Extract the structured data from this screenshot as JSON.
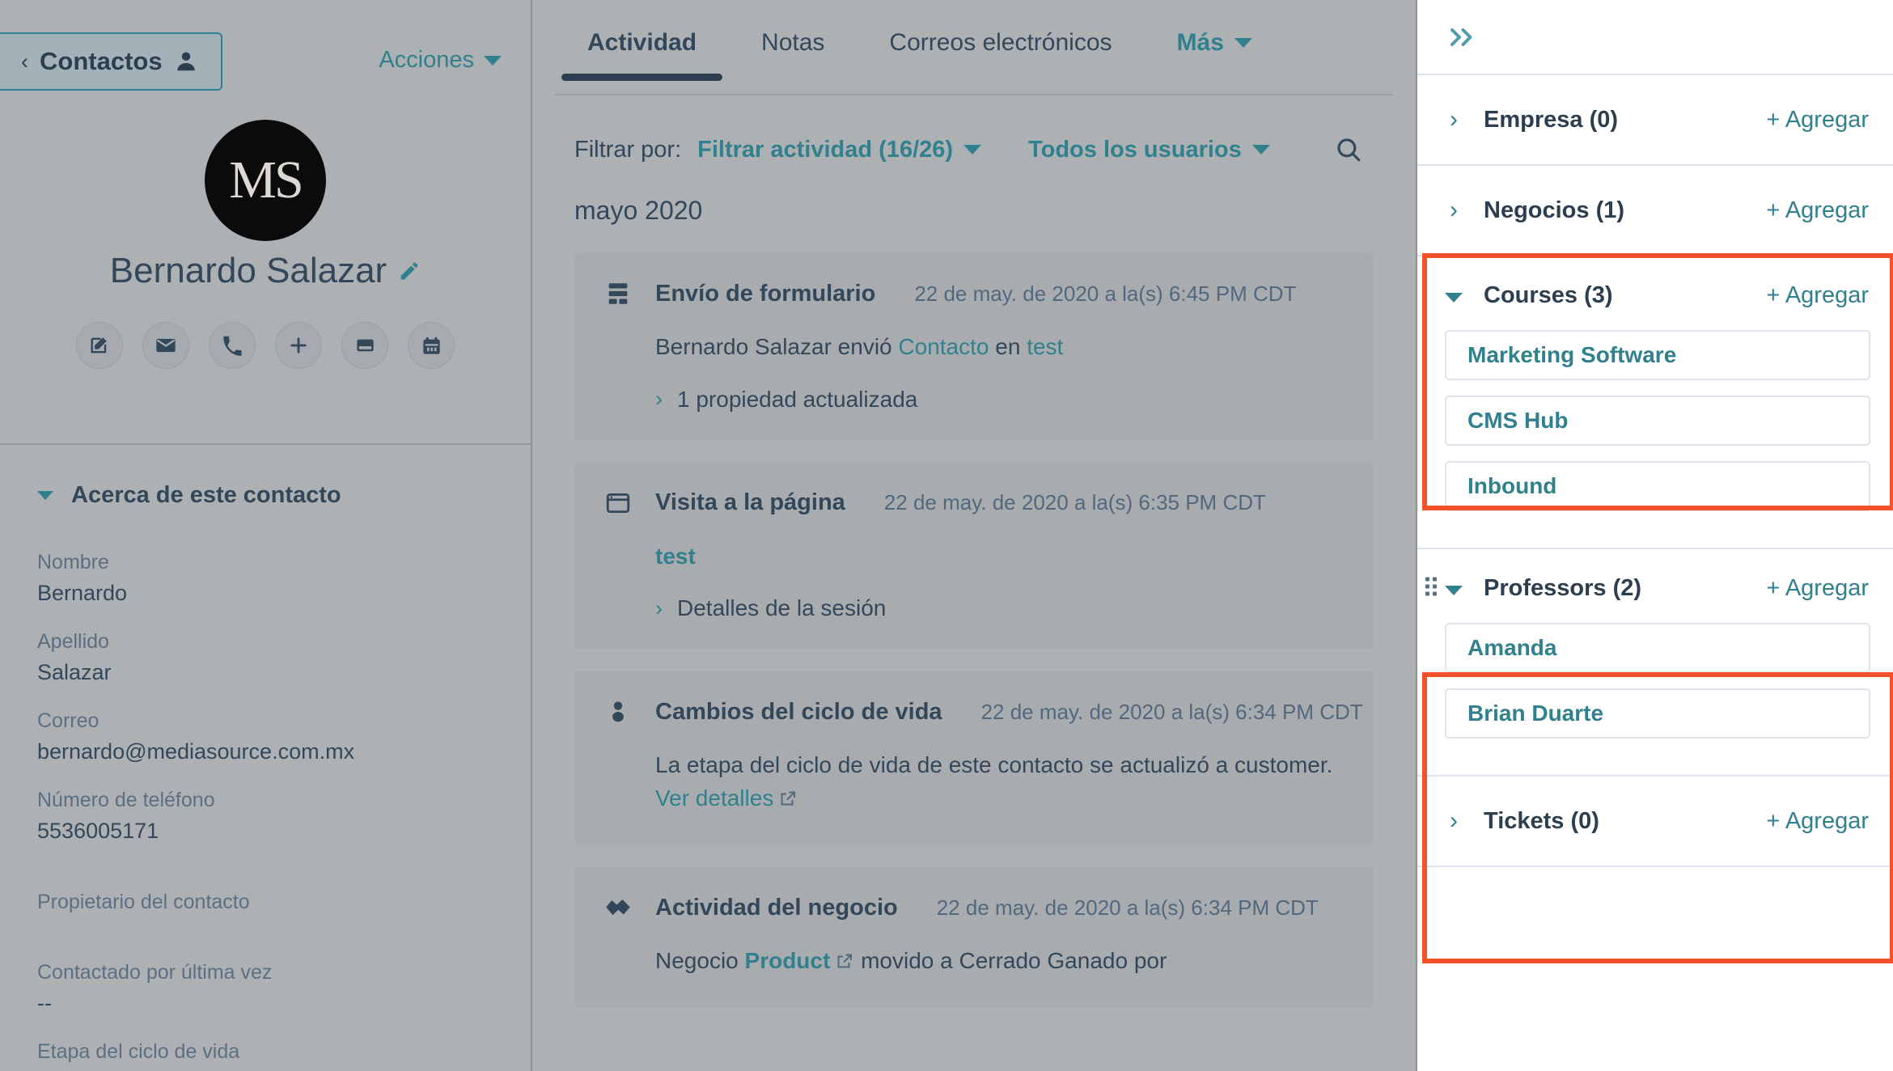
{
  "left": {
    "back_button": {
      "label": "Contactos",
      "chevron": "chevron-left-icon",
      "person_icon": "person-icon"
    },
    "actions_menu": {
      "label": "Acciones",
      "caret": "caret-down-icon"
    },
    "avatar": {
      "initials": "MS"
    },
    "contact_name": "Bernardo Salazar",
    "edit_pencil_icon": "pencil-icon",
    "quick_actions": [
      {
        "name": "note-icon",
        "title": "Nota"
      },
      {
        "name": "email-icon",
        "title": "Correo"
      },
      {
        "name": "phone-icon",
        "title": "Llamada"
      },
      {
        "name": "plus-icon",
        "title": "Agregar"
      },
      {
        "name": "task-icon",
        "title": "Tarea"
      },
      {
        "name": "calendar-icon",
        "title": "Reunión"
      }
    ],
    "about_section": {
      "title": "Acerca de este contacto",
      "collapsed": false,
      "fields": [
        {
          "label": "Nombre",
          "value": "Bernardo"
        },
        {
          "label": "Apellido",
          "value": "Salazar"
        },
        {
          "label": "Correo",
          "value": "bernardo@mediasource.com.mx"
        },
        {
          "label": "Número de teléfono",
          "value": "5536005171"
        },
        {
          "label": "Propietario del contacto",
          "value": ""
        },
        {
          "label": "Contactado por última vez",
          "value": "--"
        },
        {
          "label": "Etapa del ciclo de vida",
          "value": ""
        }
      ]
    }
  },
  "center": {
    "tabs": [
      {
        "label": "Actividad",
        "active": true
      },
      {
        "label": "Notas",
        "active": false
      },
      {
        "label": "Correos electrónicos",
        "active": false
      },
      {
        "label": "Más",
        "active": false,
        "has_caret": true
      }
    ],
    "filter_bar": {
      "prefix": "Filtrar por:",
      "activity_filter": "Filtrar actividad (16/26)",
      "users_filter": "Todos los usuarios",
      "search_icon": "search-icon"
    },
    "month_header": "mayo 2020",
    "activity_cards": [
      {
        "icon": "form-icon",
        "title": "Envío de formulario",
        "timestamp": "22 de may. de 2020 a la(s) 6:45 PM CDT",
        "body_parts": [
          {
            "text": "Bernardo Salazar envió ",
            "link": false
          },
          {
            "text": "Contacto",
            "link": true
          },
          {
            "text": " en ",
            "link": false
          },
          {
            "text": "test",
            "link": true
          }
        ],
        "expand": {
          "label": "1 propiedad actualizada",
          "chevron": "chevron-right-icon"
        }
      },
      {
        "icon": "page-view-icon",
        "title": "Visita a la página",
        "timestamp": "22 de may. de 2020 a la(s) 6:35 PM CDT",
        "body_parts": [
          {
            "text": "test",
            "link": true,
            "bold": true
          }
        ],
        "expand": {
          "label": "Detalles de la sesión",
          "chevron": "chevron-right-icon"
        }
      },
      {
        "icon": "lifecycle-icon",
        "title": "Cambios del ciclo de vida",
        "timestamp": "22 de may. de 2020 a la(s) 6:34 PM CDT",
        "body_parts": [
          {
            "text": "La etapa del ciclo de vida de este contacto se actualizó a customer. ",
            "link": false
          },
          {
            "text": "Ver detalles",
            "link": true,
            "external": true
          }
        ],
        "expand": null
      },
      {
        "icon": "deal-icon",
        "title": "Actividad del negocio",
        "timestamp": "22 de may. de 2020 a la(s) 6:34 PM CDT",
        "body_parts": [
          {
            "text": "Negocio ",
            "link": false
          },
          {
            "text": "Product",
            "link": true,
            "bold": true,
            "external": true
          },
          {
            "text": " movido a Cerrado Ganado por",
            "link": false
          }
        ],
        "expand": null
      }
    ]
  },
  "right": {
    "collapse_icon": "double-chevron-right-icon",
    "add_label": "+ Agregar",
    "associations": [
      {
        "title": "Empresa (0)",
        "expanded": false,
        "items": [],
        "highlighted": false,
        "draggable": false
      },
      {
        "title": "Negocios (1)",
        "expanded": false,
        "items": [],
        "highlighted": false,
        "draggable": false
      },
      {
        "title": "Courses (3)",
        "expanded": true,
        "items": [
          "Marketing Software",
          "CMS Hub",
          "Inbound"
        ],
        "highlighted": true,
        "draggable": false
      },
      {
        "title": "Professors (2)",
        "expanded": true,
        "items": [
          "Amanda",
          "Brian Duarte"
        ],
        "highlighted": true,
        "draggable": true
      },
      {
        "title": "Tickets (0)",
        "expanded": false,
        "items": [],
        "highlighted": false,
        "draggable": false
      }
    ]
  },
  "colors": {
    "teal_link": "#31808e",
    "dark_navy": "#33475b",
    "highlight_red": "#f2512a",
    "panel_white": "#ffffff",
    "overlay_gray": "#aeb1b4",
    "border_gray": "#dfe3eb"
  }
}
